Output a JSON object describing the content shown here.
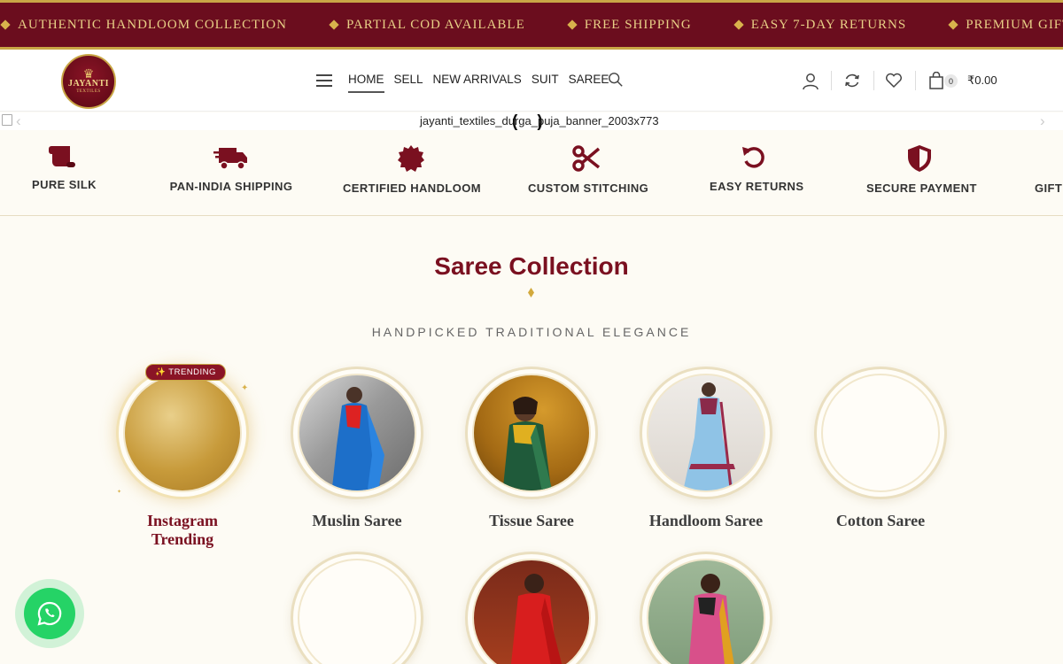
{
  "marquee": {
    "items": [
      "AUTHENTIC HANDLOOM COLLECTION",
      "PARTIAL COD AVAILABLE",
      "FREE SHIPPING",
      "EASY 7-DAY RETURNS",
      "PREMIUM GIFT WRAPPING"
    ]
  },
  "header": {
    "logo_text": "JAYANTI",
    "logo_subtext": "TEXTILES",
    "nav": [
      "HOME",
      "SELL",
      "NEW ARRIVALS",
      "SUIT",
      "SAREE"
    ],
    "cart_count": "0",
    "cart_total": "₹0.00"
  },
  "banner": {
    "alt_text": "jayanti_textiles_durga_puja_banner_2003x773"
  },
  "features": [
    {
      "label": "PURE SILK",
      "icon": "scroll-icon"
    },
    {
      "label": "PAN-INDIA SHIPPING",
      "icon": "truck-icon"
    },
    {
      "label": "CERTIFIED HANDLOOM",
      "icon": "certificate-icon"
    },
    {
      "label": "CUSTOM STITCHING",
      "icon": "scissors-icon"
    },
    {
      "label": "EASY RETURNS",
      "icon": "undo-icon"
    },
    {
      "label": "SECURE PAYMENT",
      "icon": "shield-icon"
    },
    {
      "label": "GIFT",
      "icon": "gift-icon"
    }
  ],
  "section": {
    "title": "Saree Collection",
    "subtitle": "HANDPICKED TRADITIONAL ELEGANCE"
  },
  "categories": [
    {
      "label": "Instagram Trending",
      "badge": "✨ TRENDING"
    },
    {
      "label": "Muslin Saree"
    },
    {
      "label": "Tissue Saree"
    },
    {
      "label": "Handloom Saree"
    },
    {
      "label": "Cotton Saree"
    }
  ],
  "colors": {
    "brand_maroon": "#6b0d1e",
    "gold": "#c9a646",
    "whatsapp_green": "#25d366"
  }
}
